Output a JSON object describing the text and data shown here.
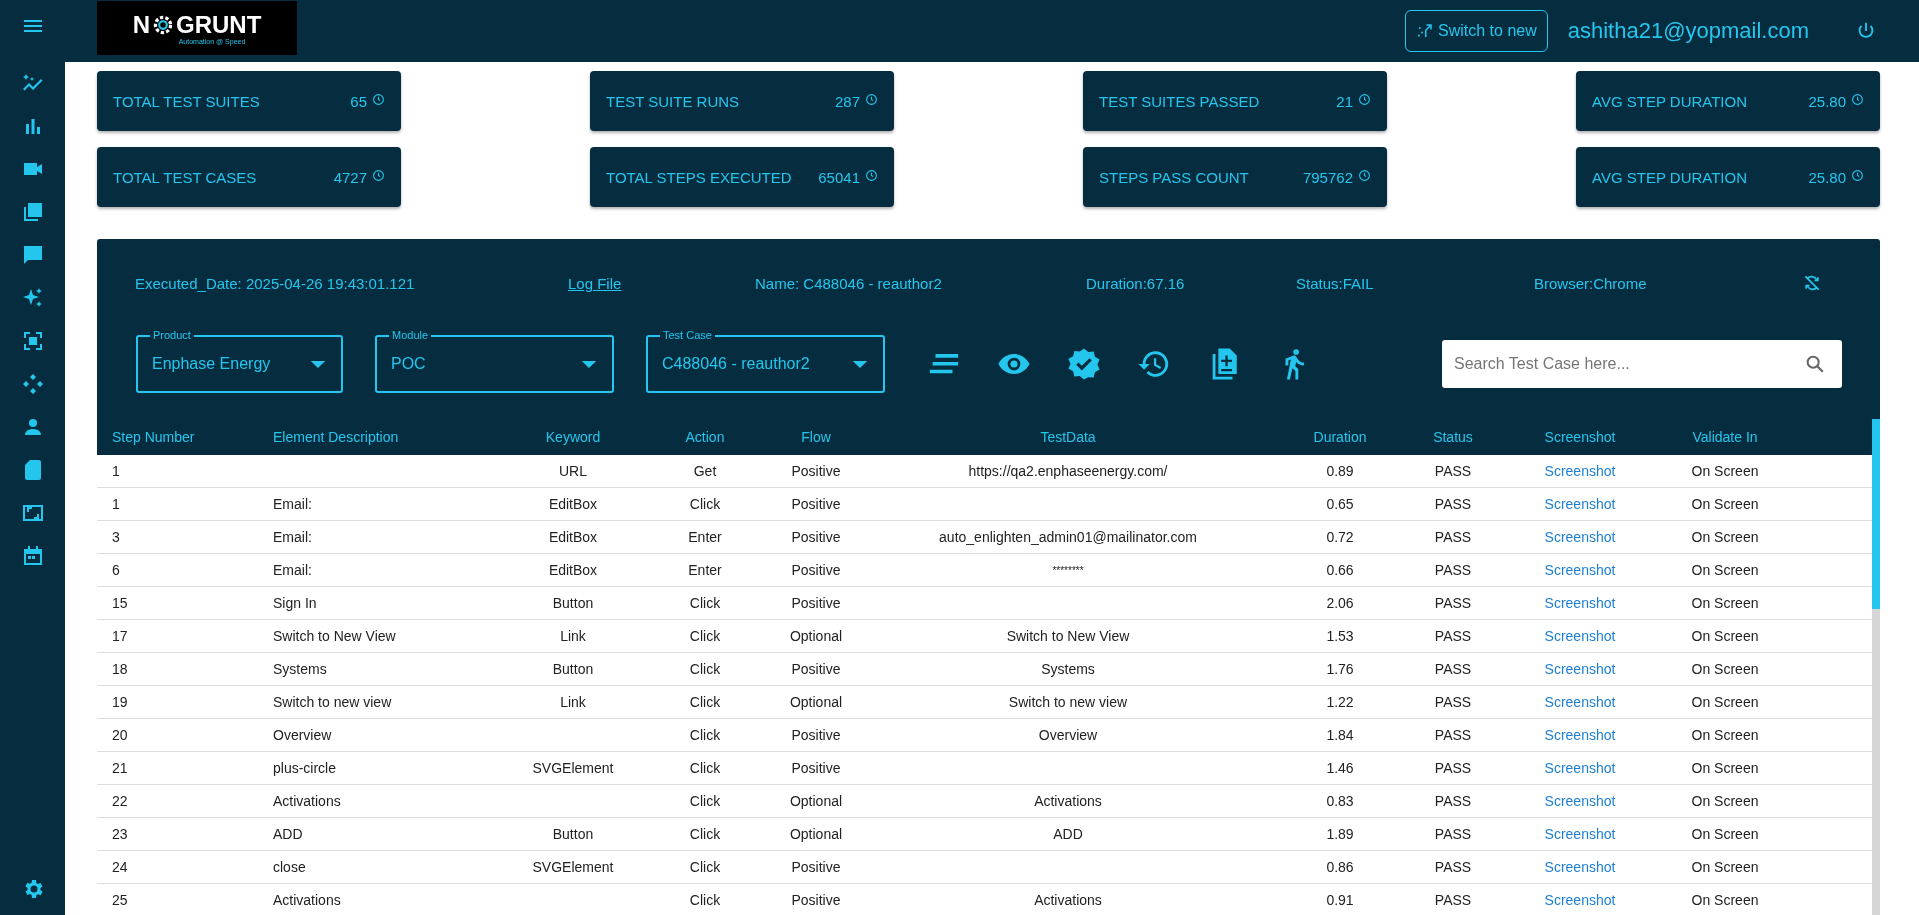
{
  "header": {
    "logo": {
      "before": "N",
      "after": "GRUNT",
      "tagline": "Automation @ Speed"
    },
    "switch_button": "Switch to new",
    "user_email": "ashitha21@yopmail.com"
  },
  "stats": [
    {
      "label": "TOTAL TEST SUITES",
      "value": "65"
    },
    {
      "label": "TEST SUITE RUNS",
      "value": "287"
    },
    {
      "label": "TEST SUITES PASSED",
      "value": "21"
    },
    {
      "label": "AVG STEP DURATION",
      "value": "25.80"
    },
    {
      "label": "TOTAL TEST CASES",
      "value": "4727"
    },
    {
      "label": "TOTAL STEPS EXECUTED",
      "value": "65041"
    },
    {
      "label": "STEPS PASS COUNT",
      "value": "795762"
    },
    {
      "label": "AVG STEP DURATION",
      "value": "25.80"
    }
  ],
  "run_info": {
    "executed_date": "Executed_Date: 2025-04-26 19:43:01.121",
    "log_file": "Log File",
    "name": "Name: C488046 - reauthor2",
    "duration": "Duration:67.16",
    "status": "Status:FAIL",
    "browser": "Browser:Chrome"
  },
  "filters": [
    {
      "label": "Product",
      "value": "Enphase Energy"
    },
    {
      "label": "Module",
      "value": "POC"
    },
    {
      "label": "Test Case",
      "value": "C488046 - reauthor2"
    }
  ],
  "search": {
    "placeholder": "Search Test Case here..."
  },
  "table": {
    "columns": [
      "Step Number",
      "Element Description",
      "Keyword",
      "Action",
      "Flow",
      "TestData",
      "Duration",
      "Status",
      "Screenshot",
      "Validate In"
    ],
    "rows": [
      [
        "1",
        "",
        "URL",
        "Get",
        "Positive",
        "https://qa2.enphaseenergy.com/",
        "0.89",
        "PASS",
        "Screenshot",
        "On Screen"
      ],
      [
        "1",
        "Email:",
        "EditBox",
        "Click",
        "Positive",
        "",
        "0.65",
        "PASS",
        "Screenshot",
        "On Screen"
      ],
      [
        "3",
        "Email:",
        "EditBox",
        "Enter",
        "Positive",
        "auto_enlighten_admin01@mailinator.com",
        "0.72",
        "PASS",
        "Screenshot",
        "On Screen"
      ],
      [
        "6",
        "Email:",
        "EditBox",
        "Enter",
        "Positive",
        "********",
        "0.66",
        "PASS",
        "Screenshot",
        "On Screen"
      ],
      [
        "15",
        "Sign In",
        "Button",
        "Click",
        "Positive",
        "",
        "2.06",
        "PASS",
        "Screenshot",
        "On Screen"
      ],
      [
        "17",
        "Switch to New View",
        "Link",
        "Click",
        "Optional",
        "Switch to New View",
        "1.53",
        "PASS",
        "Screenshot",
        "On Screen"
      ],
      [
        "18",
        "Systems",
        "Button",
        "Click",
        "Positive",
        "Systems",
        "1.76",
        "PASS",
        "Screenshot",
        "On Screen"
      ],
      [
        "19",
        "Switch to new view",
        "Link",
        "Click",
        "Optional",
        "Switch to new view",
        "1.22",
        "PASS",
        "Screenshot",
        "On Screen"
      ],
      [
        "20",
        "Overview",
        "",
        "Click",
        "Positive",
        "Overview",
        "1.84",
        "PASS",
        "Screenshot",
        "On Screen"
      ],
      [
        "21",
        "plus-circle",
        "SVGElement",
        "Click",
        "Positive",
        "",
        "1.46",
        "PASS",
        "Screenshot",
        "On Screen"
      ],
      [
        "22",
        "Activations",
        "",
        "Click",
        "Optional",
        "Activations",
        "0.83",
        "PASS",
        "Screenshot",
        "On Screen"
      ],
      [
        "23",
        "ADD",
        "Button",
        "Click",
        "Optional",
        "ADD",
        "1.89",
        "PASS",
        "Screenshot",
        "On Screen"
      ],
      [
        "24",
        "close",
        "SVGElement",
        "Click",
        "Positive",
        "",
        "0.86",
        "PASS",
        "Screenshot",
        "On Screen"
      ],
      [
        "25",
        "Activations",
        "",
        "Click",
        "Positive",
        "Activations",
        "0.91",
        "PASS",
        "Screenshot",
        "On Screen"
      ]
    ]
  }
}
